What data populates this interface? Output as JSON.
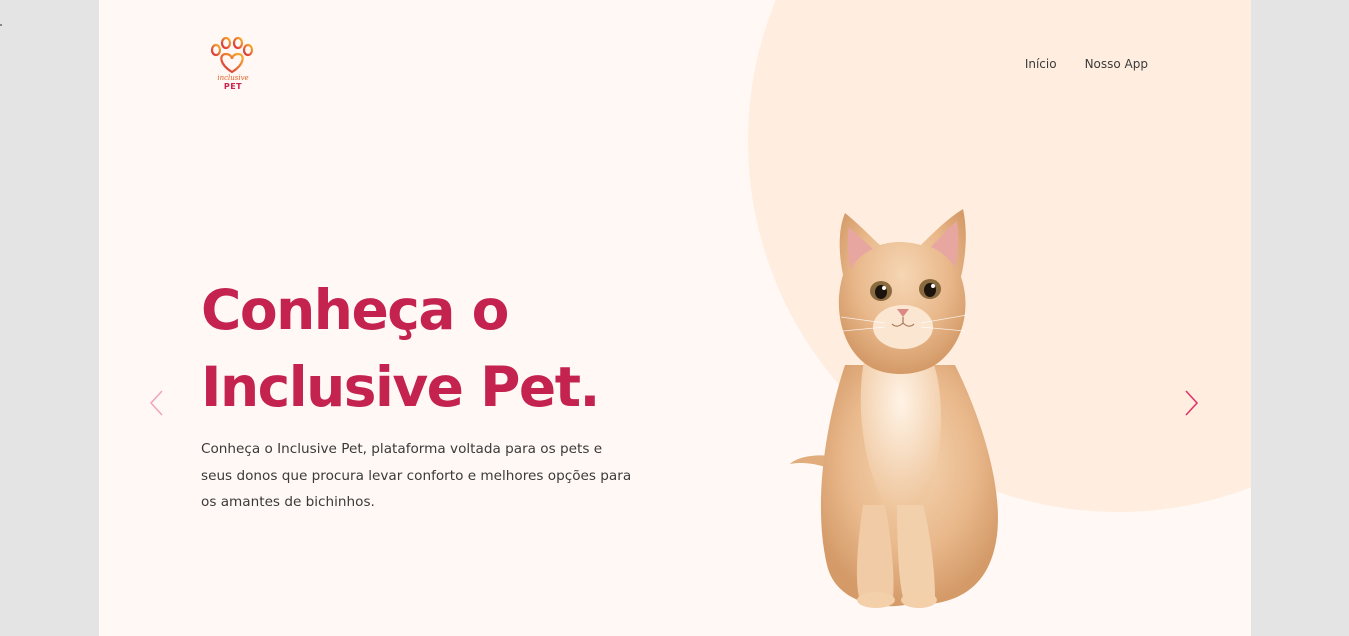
{
  "brand": {
    "logo_script": "inclusive",
    "logo_text": "PET",
    "colors": {
      "primary": "#c4224f",
      "accent_orange": "#f5a623",
      "background": "#fff8f4",
      "circle": "#ffeedf"
    }
  },
  "nav": {
    "items": [
      {
        "label": "Início"
      },
      {
        "label": "Nosso App"
      }
    ]
  },
  "hero": {
    "title_line1": "Conheça o",
    "title_line2": "Inclusive Pet.",
    "description": "Conheça o Inclusive Pet, plataforma voltada para os pets e seus donos que procura levar conforto e melhores opções para os amantes de bichinhos."
  },
  "carousel": {
    "prev_icon": "chevron-left-icon",
    "next_icon": "chevron-right-icon"
  },
  "image": {
    "subject": "kitten"
  }
}
